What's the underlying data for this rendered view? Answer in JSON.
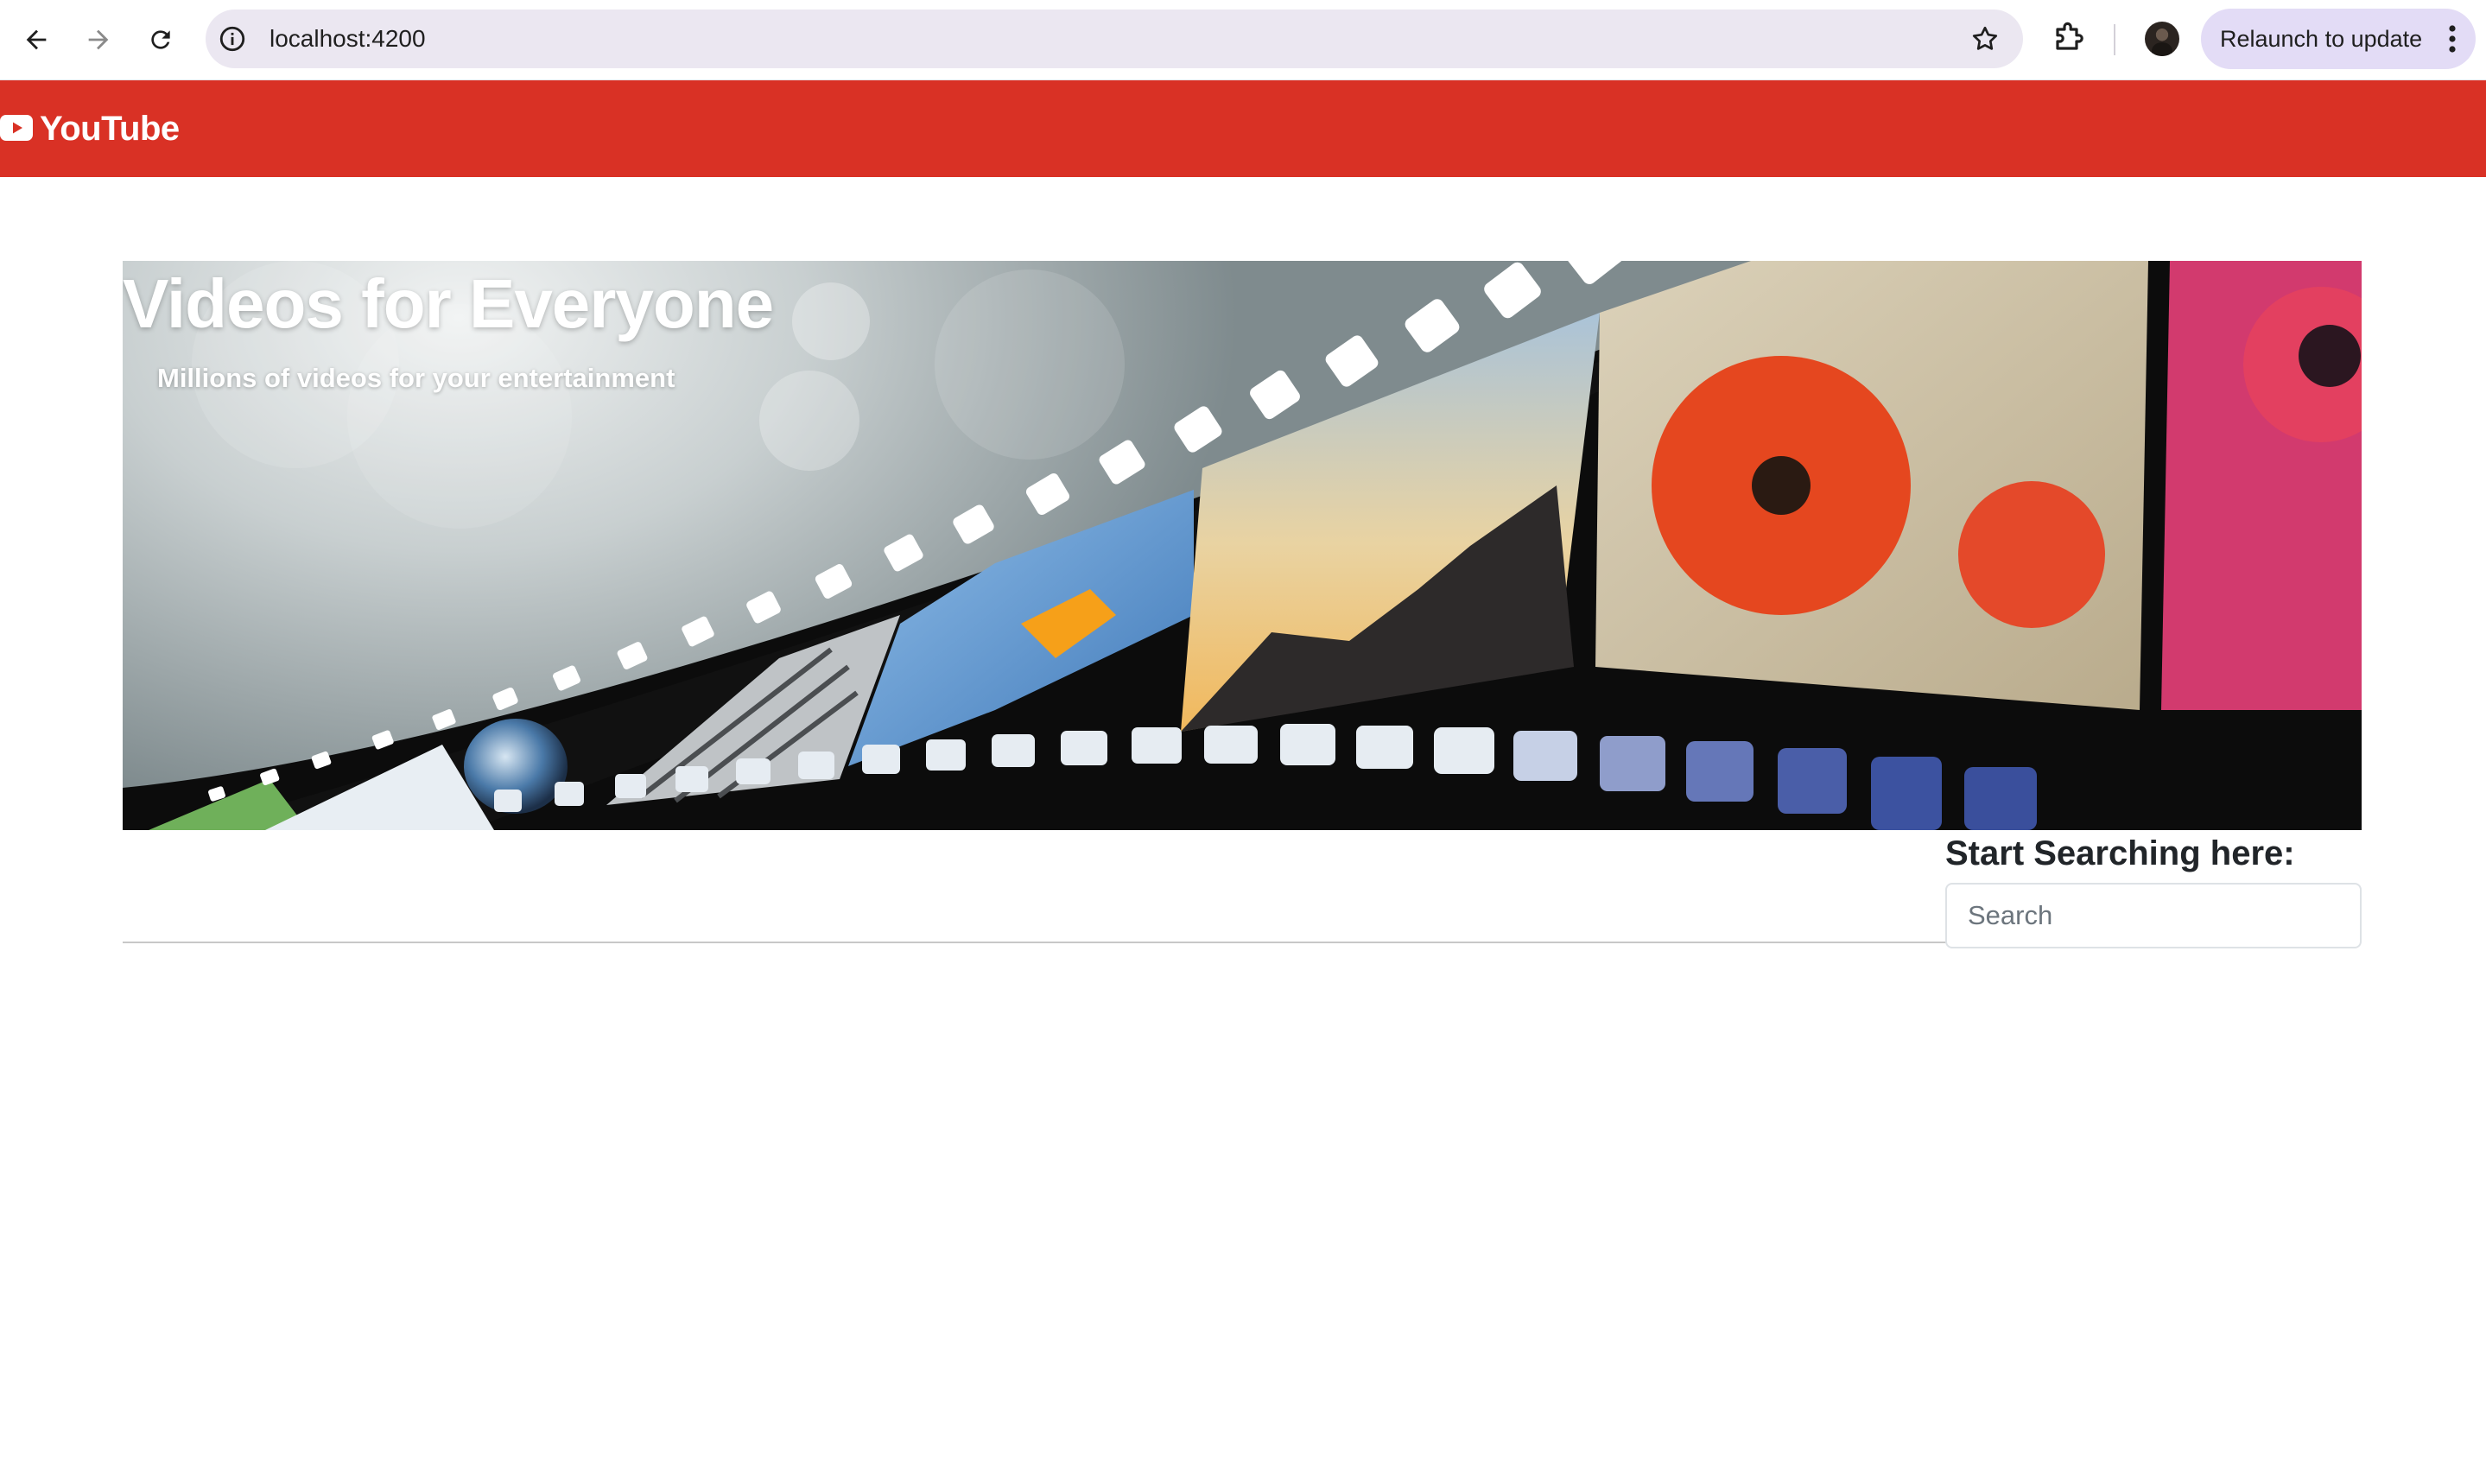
{
  "browser": {
    "url": "localhost:4200",
    "relaunch_label": "Relaunch to update",
    "icons": [
      "back-arrow-icon",
      "forward-arrow-icon",
      "reload-icon",
      "site-info-icon",
      "bookmark-star-icon",
      "extensions-icon",
      "profile-avatar",
      "more-vert-icon"
    ]
  },
  "header": {
    "brand": "YouTube",
    "logo_icon": "youtube-play-icon",
    "background_color": "#d93125"
  },
  "hero": {
    "title": "Videos for Everyone",
    "subtitle": "Millions of videos for your entertainment"
  },
  "search": {
    "heading": "Start Searching here:",
    "placeholder": "Search",
    "value": ""
  }
}
